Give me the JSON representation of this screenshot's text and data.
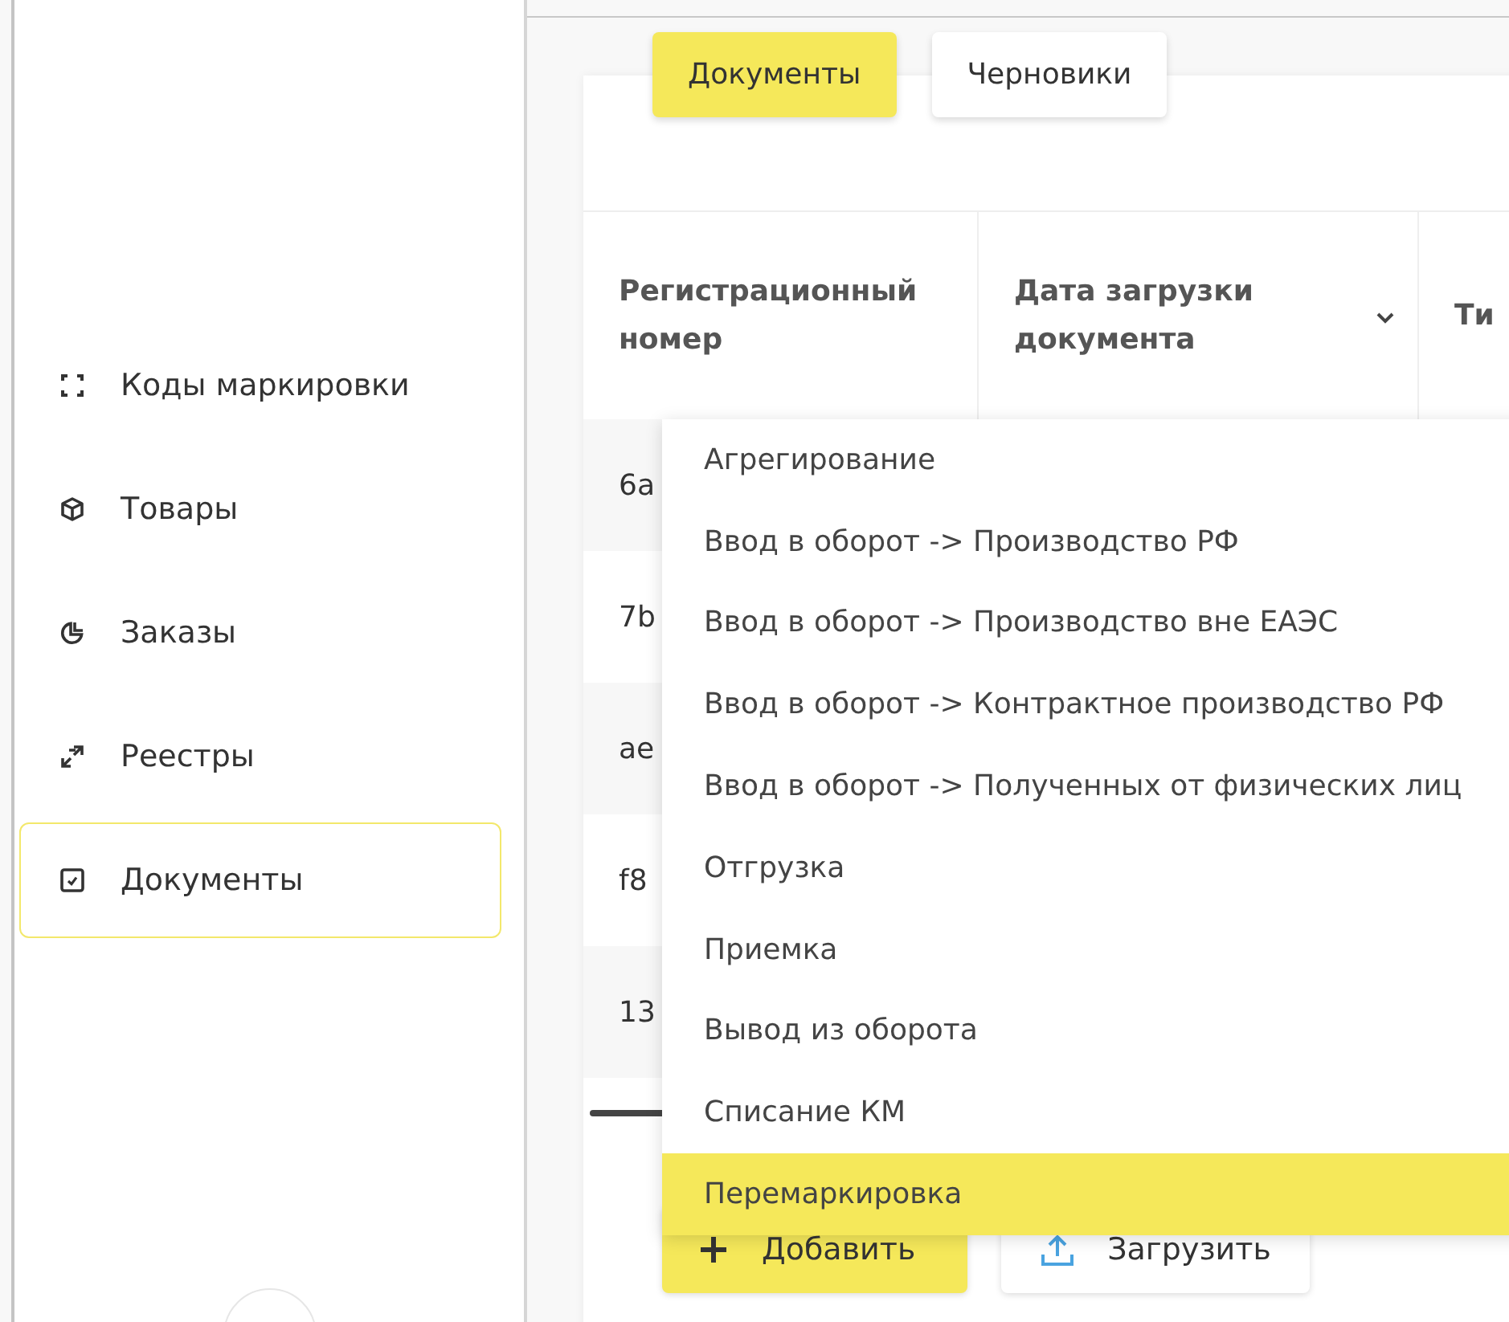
{
  "sidebar": {
    "items": [
      {
        "label": "Коды маркировки",
        "kind": "scan",
        "selected": false
      },
      {
        "label": "Товары",
        "kind": "box",
        "selected": false
      },
      {
        "label": "Заказы",
        "kind": "pie",
        "selected": false
      },
      {
        "label": "Реестры",
        "kind": "arrows",
        "selected": false
      },
      {
        "label": "Документы",
        "kind": "check",
        "selected": true
      }
    ]
  },
  "tabs": [
    {
      "label": "Документы",
      "selected": true
    },
    {
      "label": "Черновики",
      "selected": false
    }
  ],
  "table": {
    "columns": [
      {
        "label": "Регистрационный номер",
        "sortable": false
      },
      {
        "label": "Дата загрузки документа",
        "sortable": true
      },
      {
        "label": "Ти"
      }
    ],
    "rows": [
      [
        "6a"
      ],
      [
        "7b"
      ],
      [
        "ae"
      ],
      [
        "f8"
      ],
      [
        "13"
      ]
    ]
  },
  "menu": {
    "items": [
      {
        "label": "Агрегирование",
        "selected": false
      },
      {
        "label": "Ввод в оборот -> Производство РФ",
        "selected": false
      },
      {
        "label": "Ввод в оборот -> Производство вне ЕАЭС",
        "selected": false
      },
      {
        "label": "Ввод в оборот -> Контрактное производство РФ",
        "selected": false
      },
      {
        "label": "Ввод в оборот -> Полученных от физических лиц",
        "selected": false
      },
      {
        "label": "Отгрузка",
        "selected": false
      },
      {
        "label": "Приемка",
        "selected": false
      },
      {
        "label": "Вывод из оборота",
        "selected": false
      },
      {
        "label": "Списание КМ",
        "selected": false
      },
      {
        "label": "Перемаркировка",
        "selected": true
      }
    ]
  },
  "buttons": [
    {
      "label": "Добавить",
      "kind": "primary"
    },
    {
      "label": "Загрузить",
      "kind": "secondary"
    }
  ]
}
